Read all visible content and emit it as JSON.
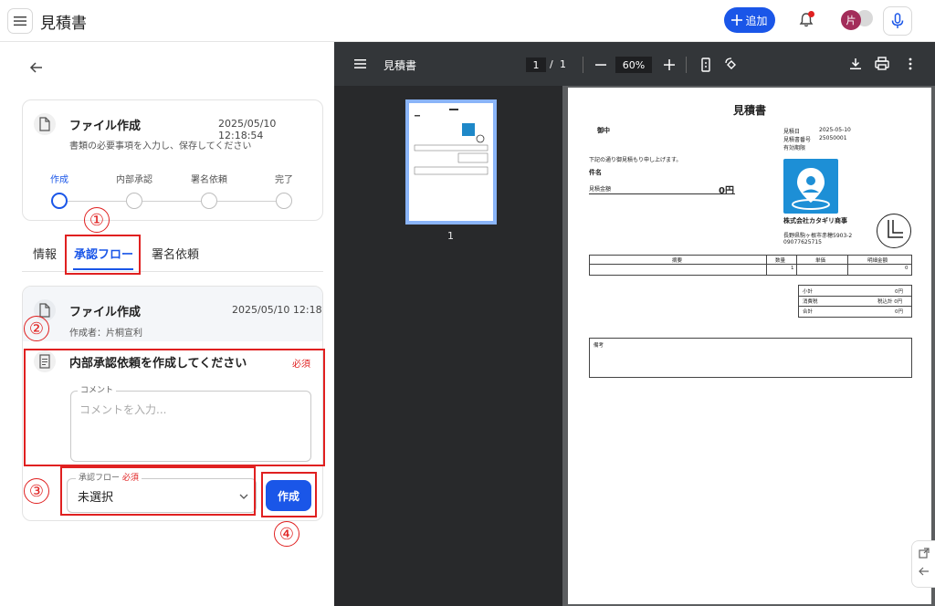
{
  "app": {
    "title": "見積書"
  },
  "header": {
    "add_label": "追加",
    "avatar_initial": "片"
  },
  "card1": {
    "title": "ファイル作成",
    "date": "2025/05/10 12:18:54",
    "subtitle": "書類の必要事項を入力し、保存してください",
    "steps": [
      "作成",
      "内部承認",
      "署名依頼",
      "完了"
    ]
  },
  "tabs": [
    "情報",
    "承認フロー",
    "署名依頼"
  ],
  "card2": {
    "title": "ファイル作成",
    "date": "2025/05/10 12:18",
    "creator": "作成者：片桐宣利",
    "request_title": "内部承認依頼を作成してください",
    "required": "必須",
    "comment_label": "コメント",
    "comment_placeholder": "コメントを入力...",
    "flow_label": "承認フロー",
    "flow_required": "必須",
    "flow_value": "未選択",
    "create_label": "作成"
  },
  "annotations": [
    "①",
    "②",
    "③",
    "④"
  ],
  "viewer": {
    "title": "見積書",
    "page_current": "1",
    "page_sep": "/",
    "page_total": "1",
    "zoom": "60%",
    "thumb_number": "1"
  },
  "doc": {
    "title": "見積書",
    "recipient": "御中",
    "date_label": "見積日",
    "date_value": "2025-05-10",
    "number_label": "見積書番号",
    "number_value": "25050001",
    "valid_label": "有効期限",
    "intro": "下記の通り御見積もり申し上げます。",
    "subject_label": "件名",
    "amount_label": "見積金額",
    "amount_value": "0円",
    "company": "株式会社カタギリ商事",
    "address": "長野県駒ヶ根市赤穂5903-2",
    "phone": "09077625715",
    "columns": [
      "摘要",
      "数量",
      "単価",
      "明細金額"
    ],
    "row": {
      "desc": "",
      "qty": "1",
      "price": "",
      "amount": "0"
    },
    "subtotal_label": "小計",
    "subtotal_value": "0円",
    "tax_label": "消費税",
    "tax_value": "税込計 0円",
    "total_label": "合計",
    "total_value": "0円",
    "notes_label": "備考"
  },
  "colors": {
    "accent": "#1a56e8",
    "annotation": "#e02020",
    "viewer_bg": "#5c5e60"
  }
}
